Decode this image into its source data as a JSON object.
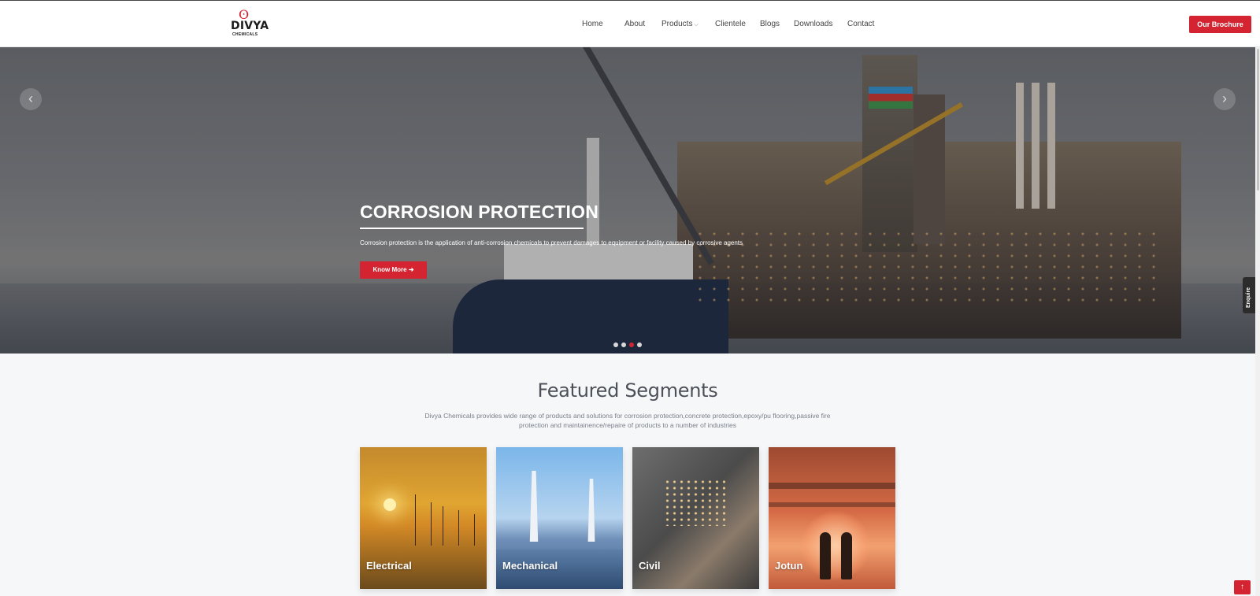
{
  "brand": {
    "name": "DIVYA",
    "subtitle": "CHEMICALS"
  },
  "nav": {
    "home": "Home",
    "about": "About",
    "products": "Products",
    "clientele": "Clientele",
    "blogs": "Blogs",
    "downloads": "Downloads",
    "contact": "Contact"
  },
  "header": {
    "brochure_label": "Our Brochure"
  },
  "hero": {
    "title": "CORROSION PROTECTION",
    "description": "Corrosion protection is the application of anti-corrosion chemicals to prevent damages to equipment or facility caused by corrosive agents",
    "cta_label": "Know More",
    "cta_icon": "arrow-right-icon",
    "slides_count": 4,
    "active_slide": 3
  },
  "enquire": {
    "label": "Enquire"
  },
  "featured": {
    "title": "Featured Segments",
    "description": "Divya Chemicals provides wide range of products and solutions for corrosion protection,concrete protection,epoxy/pu flooring,passive fire protection and maintainence/repaire of products to a number of industries",
    "cards": [
      {
        "label": "Electrical"
      },
      {
        "label": "Mechanical"
      },
      {
        "label": "Civil"
      },
      {
        "label": "Jotun"
      }
    ]
  },
  "colors": {
    "accent": "#d42431",
    "nav_text": "#444444",
    "heading": "#4c5058"
  }
}
